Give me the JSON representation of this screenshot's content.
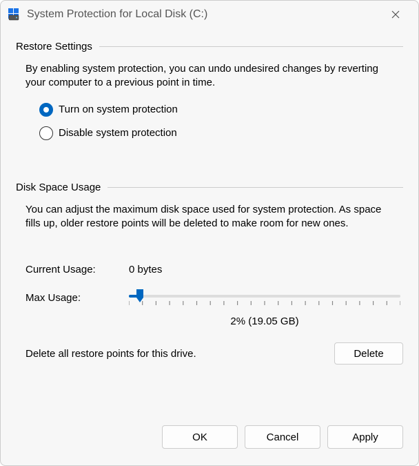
{
  "window": {
    "title": "System Protection for Local Disk (C:)"
  },
  "restore": {
    "section_label": "Restore Settings",
    "description": "By enabling system protection, you can undo undesired changes by reverting your computer to a previous point in time.",
    "option_on": "Turn on system protection",
    "option_off": "Disable system protection",
    "selected": "on"
  },
  "usage": {
    "section_label": "Disk Space Usage",
    "description": "You can adjust the maximum disk space used for system protection. As space fills up, older restore points will be deleted to make room for new ones.",
    "current_label": "Current Usage:",
    "current_value": "0 bytes",
    "max_label": "Max Usage:",
    "slider_percent": 2,
    "slider_value_text": "2% (19.05 GB)",
    "delete_text": "Delete all restore points for this drive.",
    "delete_button": "Delete"
  },
  "footer": {
    "ok": "OK",
    "cancel": "Cancel",
    "apply": "Apply"
  },
  "icons": {
    "app": "system-protection-icon",
    "close": "close-icon"
  }
}
